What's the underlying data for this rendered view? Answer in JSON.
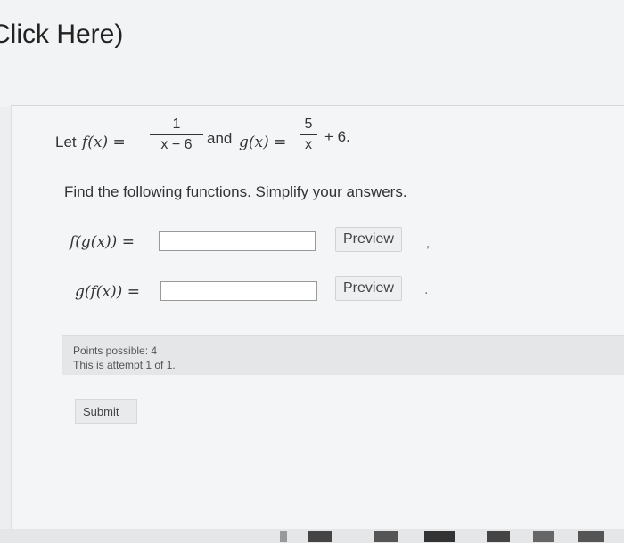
{
  "link": {
    "click_here": "Click Here)"
  },
  "problem": {
    "let": "Let",
    "f_def": "f(x) =",
    "f_num": "1",
    "f_den": "x − 6",
    "and": "and",
    "g_def": "g(x) =",
    "g_num": "5",
    "g_den": "x",
    "g_tail": "+ 6."
  },
  "instruction": "Find the following functions. Simplify your answers.",
  "questions": [
    {
      "label": "f(g(x)) =",
      "value": "",
      "preview_label": "Preview"
    },
    {
      "label": "g(f(x)) =",
      "value": "",
      "preview_label": "Preview"
    }
  ],
  "points": {
    "possible": "Points possible: 4",
    "attempt": "This is attempt 1 of 1."
  },
  "submit_label": "Submit"
}
